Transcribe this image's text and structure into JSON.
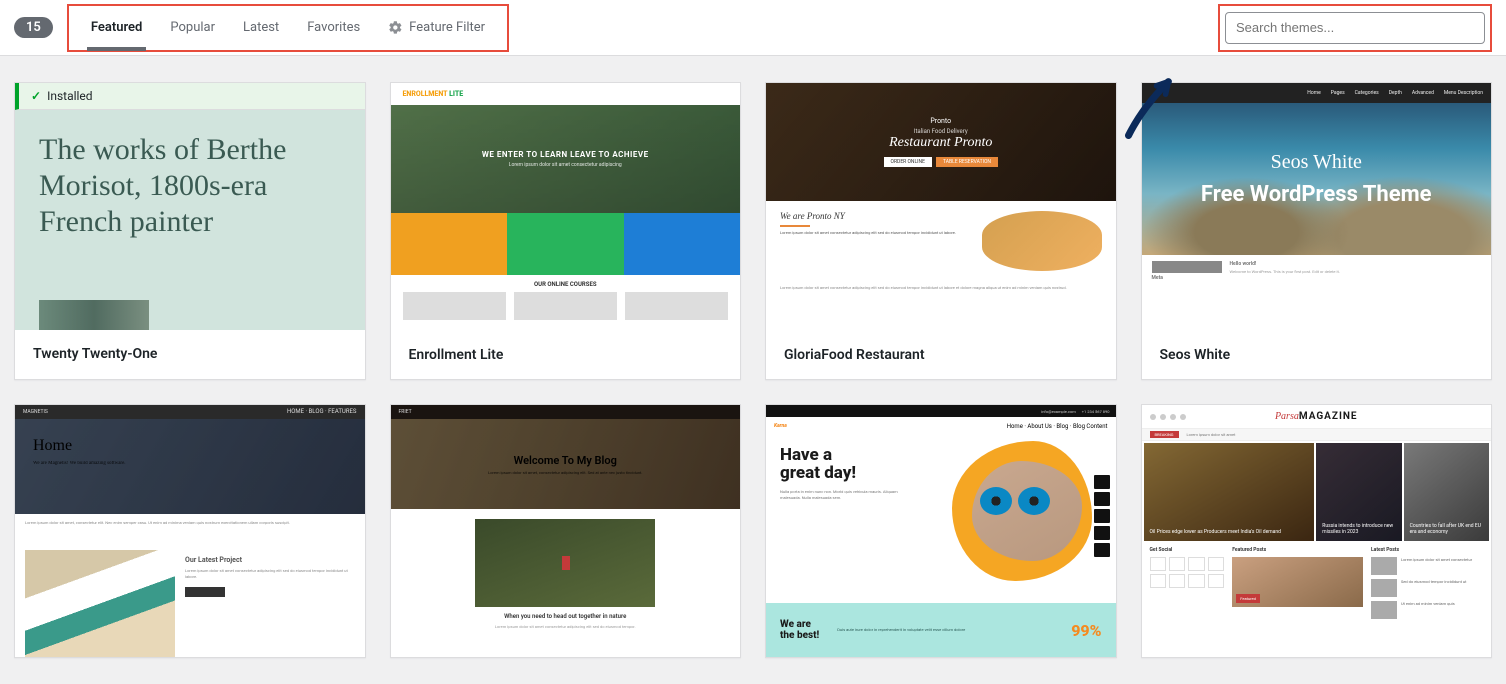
{
  "toolbar": {
    "count": "15",
    "tabs": {
      "featured": "Featured",
      "popular": "Popular",
      "latest": "Latest",
      "favorites": "Favorites",
      "feature_filter": "Feature Filter"
    },
    "search_placeholder": "Search themes..."
  },
  "themes": {
    "twentytwentyone": {
      "installed_label": "Installed",
      "headline": "The works of Berthe Morisot, 1800s-era French painter",
      "name": "Twenty Twenty-One"
    },
    "enrollment": {
      "logo_a": "ENROLLMENT",
      "logo_b": " LITE",
      "hero_h": "WE ENTER TO LEARN LEAVE TO ACHIEVE",
      "hero_s": "Lorem ipsum dolor sit amet consectetur adipiscing",
      "courses_title": "OUR ONLINE COURSES",
      "name": "Enrollment Lite"
    },
    "gloriafood": {
      "logo": "Pronto",
      "sub": "Italian Food Delivery",
      "title": "Restaurant Pronto",
      "btn1": "ORDER ONLINE",
      "btn2": "TABLE RESERVATION",
      "mid_title": "We are Pronto NY",
      "name": "GloriaFood Restaurant"
    },
    "seos": {
      "nav": {
        "home": "Home",
        "pages": "Pages",
        "categories": "Categories",
        "depth": "Depth",
        "advanced": "Advanced",
        "menudesc": "Menu Description"
      },
      "t1": "Seos White",
      "t2": "Free WordPress Theme",
      "sb_meta": "Meta",
      "sb_hello": "Hello world!",
      "name": "Seos White"
    },
    "magnetis": {
      "logo": "MAGNETIS",
      "h": "Home",
      "s": "We are Magnetis! We build amazing software.",
      "side_h": "Our Latest Project"
    },
    "friet": {
      "logo": "FRIET",
      "h": "Welcome To My Blog",
      "s": "Lorem ipsum dolor sit amet, consectetur adipiscing elit. Sed at ante nec justo tincidunt.",
      "cap": "When you need to head out together in nature"
    },
    "karna": {
      "logo": "Karna",
      "nav": "Home · About Us · Blog · Blog Content",
      "h1": "Have a",
      "h2": "great day!",
      "p": "Nulla porta in enim nunc non. Morbi quis vehicula mauris. Aliquam malesuada. Nulla malesuada sem.",
      "wb1": "We are",
      "wb2": "the best!",
      "ft": "Duis aute irure dolor in reprehenderit in voluptate velit esse cillum dolore",
      "pc": "99%"
    },
    "parsa": {
      "logo_a": "Parsa",
      "logo_b": "MAGAZINE",
      "bn": "BREAKING",
      "col1_t": "Get Social",
      "col2_t": "Featured Posts",
      "col3_t": "Latest Posts",
      "h1_t": "Oil Prices edge lower as Producers meet India's Oil demand",
      "h2_t": "Russia intends to introduce new missiles in 2023",
      "h3_t": "Countries to fall after UK end EU era and economy"
    }
  }
}
